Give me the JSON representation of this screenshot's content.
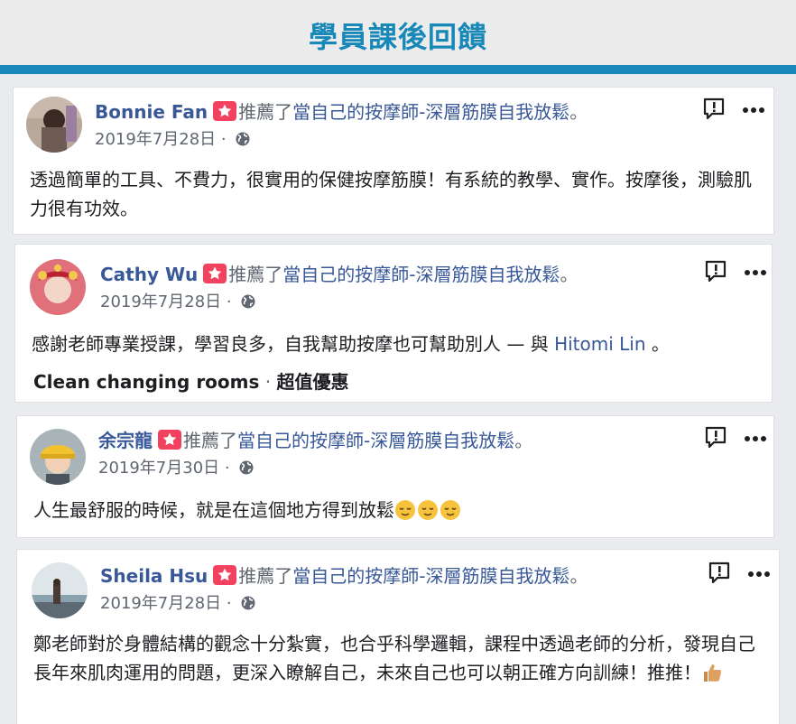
{
  "header": {
    "title": "學員課後回饋"
  },
  "posts": [
    {
      "author": "Bonnie Fan",
      "rec_text": "推薦了",
      "page_name": "當自己的按摩師-深層筋膜自我放鬆",
      "rec_end": "。",
      "date": "2019年7月28日",
      "separator": "·",
      "body": "透過簡單的工具、不費力，很實用的保健按摩筋膜！有系統的教學、實作。按摩後，測驗肌力很有功效。"
    },
    {
      "author": "Cathy Wu",
      "rec_text": "推薦了",
      "page_name": "當自己的按摩師-深層筋膜自我放鬆",
      "rec_end": "。",
      "date": "2019年7月28日",
      "separator": "·",
      "body": "感謝老師專業授課，學習良多，自我幫助按摩也可幫助別人 — 與",
      "with_friend": "Hitomi Lin",
      "body_end": "。",
      "tag_primary": "Clean changing rooms",
      "tag_sep": "·",
      "tag_secondary": "超值優惠"
    },
    {
      "author": "余宗龍",
      "rec_text": "推薦了",
      "page_name": "當自己的按摩師-深層筋膜自我放鬆",
      "rec_end": "。",
      "date": "2019年7月30日",
      "separator": "·",
      "body": "人生最舒服的時候，就是在這個地方得到放鬆",
      "emojis": [
        "relieved-face-emoji",
        "relieved-face-emoji",
        "relieved-face-emoji"
      ]
    },
    {
      "author": "Sheila Hsu",
      "rec_text": "推薦了",
      "page_name": "當自己的按摩師-深層筋膜自我放鬆",
      "rec_end": "。",
      "date": "2019年7月28日",
      "separator": "·",
      "body": "鄭老師對於身體結構的觀念十分紮實，也合乎科學邏輯，課程中透過老師的分析，發現自己長年來肌肉運用的問題，更深入瞭解自己，未來自己也可以朝正確方向訓練！推推！",
      "emojis": [
        "thumbs-up-emoji"
      ]
    }
  ],
  "colors": {
    "accent": "#1788b8",
    "link": "#385898",
    "badge": "#f3425f",
    "muted": "#606770"
  },
  "icons": [
    "star-badge-icon",
    "globe-icon",
    "report-icon",
    "more-options-icon"
  ]
}
